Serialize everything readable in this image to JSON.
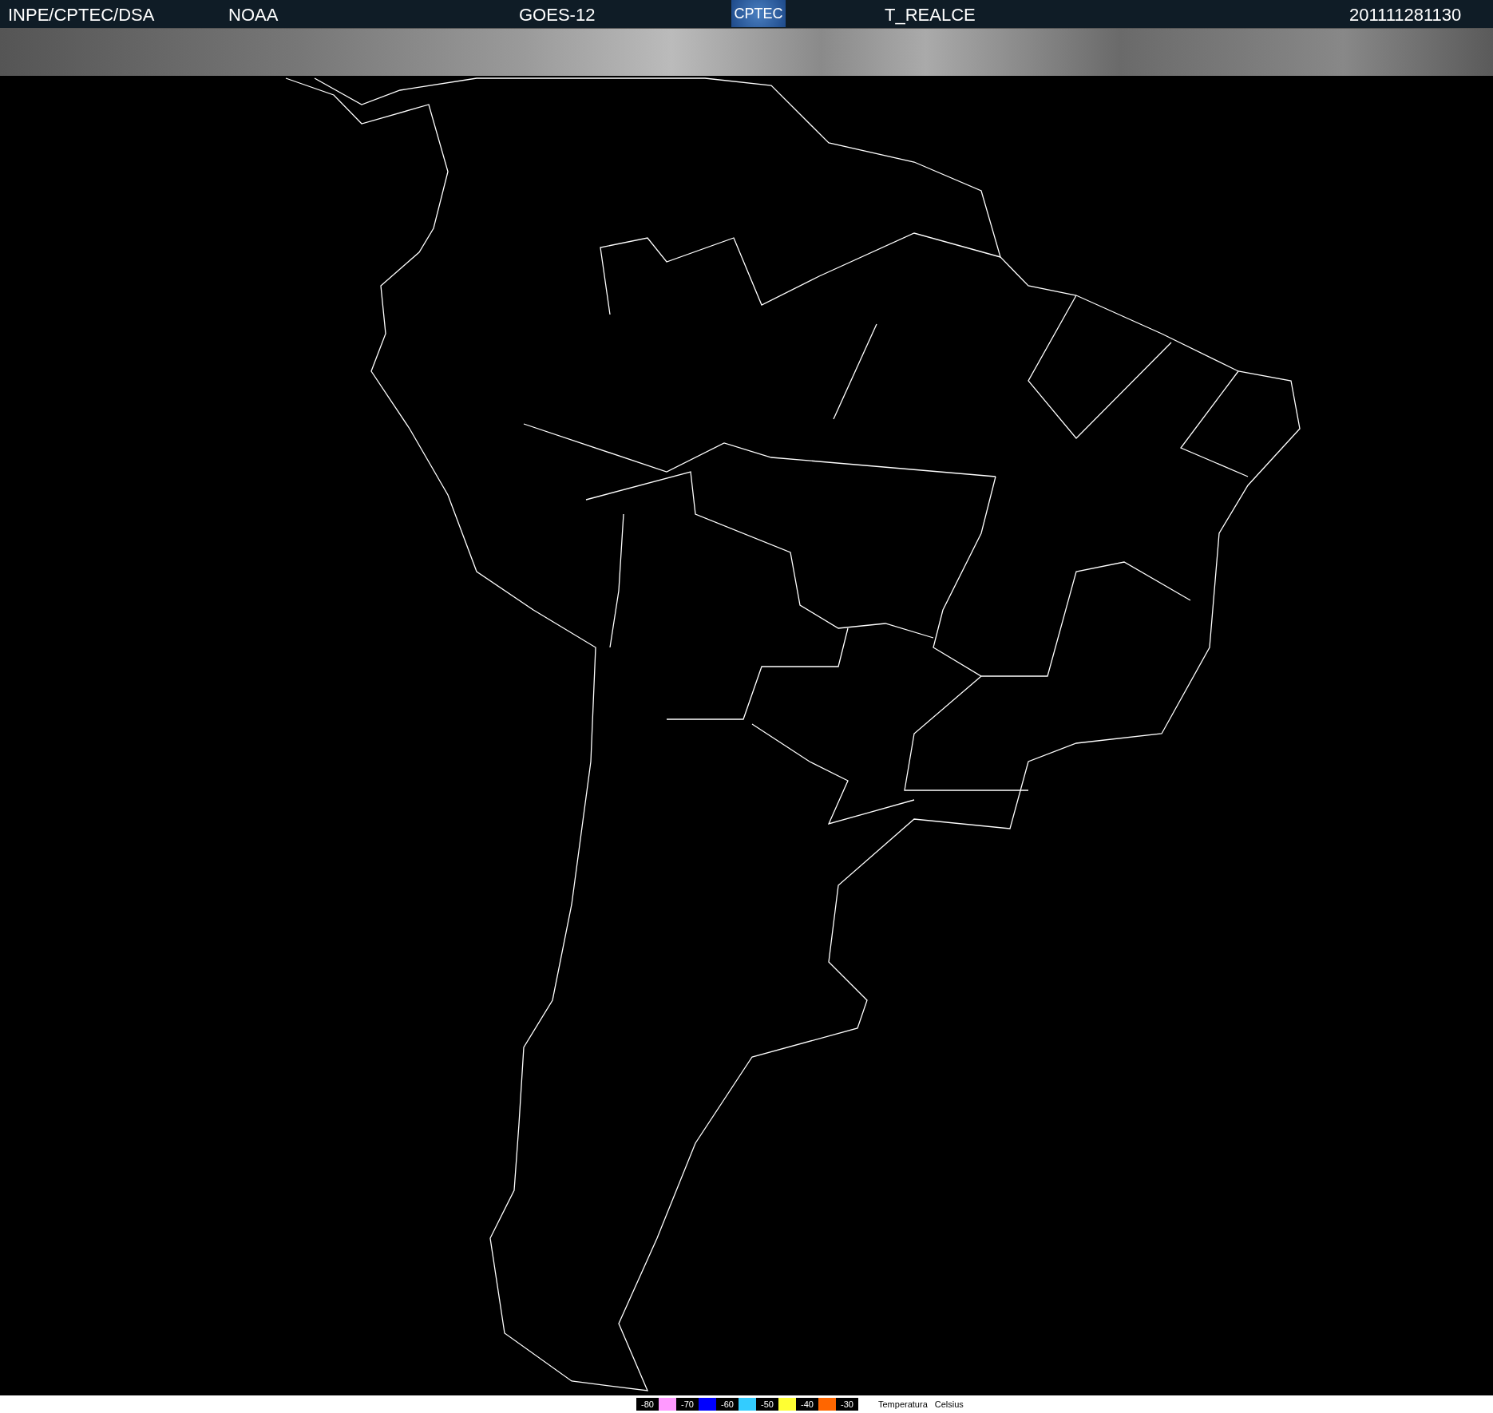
{
  "header": {
    "source": "INPE/CPTEC/DSA",
    "agency": "NOAA",
    "satellite": "GOES-12",
    "logo": "CPTEC",
    "product": "T_REALCE",
    "timestamp": "201111281130"
  },
  "legend": {
    "scale": [
      {
        "label": "-80",
        "color": "#ff99ff"
      },
      {
        "label": "-70",
        "color": "#0000ff"
      },
      {
        "label": "-60",
        "color": "#33ccff"
      },
      {
        "label": "-50",
        "color": "#ffff33"
      },
      {
        "label": "-40",
        "color": "#ff6600"
      },
      {
        "label": "-30"
      }
    ],
    "title": "Temperatura",
    "unit": "Celsius"
  }
}
